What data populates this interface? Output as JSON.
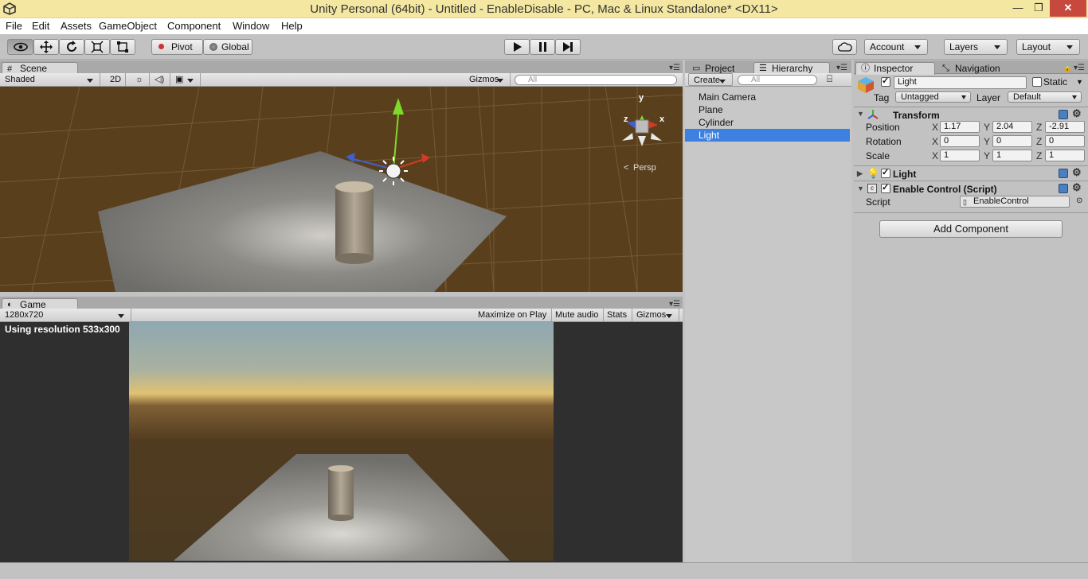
{
  "window": {
    "title": "Unity Personal (64bit) - Untitled - EnableDisable - PC, Mac & Linux Standalone* <DX11>",
    "minimize": "—",
    "maximize": "❐",
    "close": "✕"
  },
  "menu": [
    "File",
    "Edit",
    "Assets",
    "GameObject",
    "Component",
    "Window",
    "Help"
  ],
  "toolbar": {
    "pivot": "Pivot",
    "global": "Global",
    "account": "Account",
    "layers": "Layers",
    "layout": "Layout"
  },
  "scene": {
    "tab": "Scene",
    "shading": "Shaded",
    "mode2d": "2D",
    "gizmos": "Gizmos",
    "search_placeholder": "All",
    "persp": "Persp",
    "axis_y": "y",
    "axis_x": "x",
    "axis_z": "z"
  },
  "game": {
    "tab": "Game",
    "resolution": "1280x720",
    "maximize": "Maximize on Play",
    "mute": "Mute audio",
    "stats": "Stats",
    "gizmos": "Gizmos",
    "info": "Using resolution 533x300"
  },
  "hierarchy": {
    "tab_project": "Project",
    "tab_hierarchy": "Hierarchy",
    "create": "Create",
    "search_placeholder": "All",
    "items": [
      "Main Camera",
      "Plane",
      "Cylinder",
      "Light"
    ],
    "selected": "Light"
  },
  "inspector": {
    "tab": "Inspector",
    "tab_nav": "Navigation",
    "object_name": "Light",
    "static_label": "Static",
    "tag_label": "Tag",
    "tag_value": "Untagged",
    "layer_label": "Layer",
    "layer_value": "Default",
    "transform": {
      "title": "Transform",
      "position": {
        "label": "Position",
        "x": "1.17",
        "y": "2.04",
        "z": "-2.91"
      },
      "rotation": {
        "label": "Rotation",
        "x": "0",
        "y": "0",
        "z": "0"
      },
      "scale": {
        "label": "Scale",
        "x": "1",
        "y": "1",
        "z": "1"
      }
    },
    "light": {
      "title": "Light"
    },
    "script_comp": {
      "title": "Enable Control (Script)",
      "script_label": "Script",
      "script_value": "EnableControl"
    },
    "add_component": "Add Component",
    "axes": {
      "x": "X",
      "y": "Y",
      "z": "Z"
    }
  },
  "colors": {
    "titlebar": "#f4e7a1",
    "selection": "#3d80df",
    "close": "#c7483d"
  }
}
